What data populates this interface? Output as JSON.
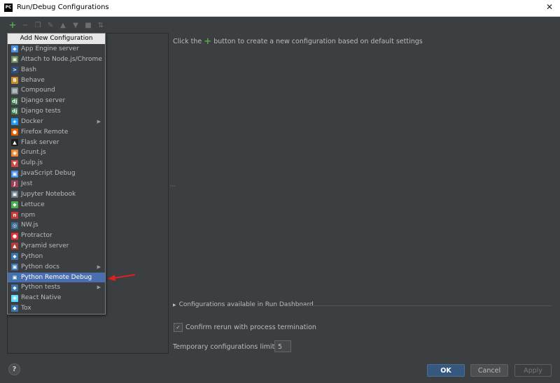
{
  "window": {
    "title": "Run/Debug Configurations",
    "app_icon_text": "PC"
  },
  "toolbar": {
    "buttons": [
      "plus-icon",
      "minus-icon",
      "copy-icon",
      "wrench-icon",
      "arrow-up-icon",
      "arrow-down-icon",
      "folder-icon",
      "sort-icon"
    ]
  },
  "popup": {
    "header": "Add New Configuration",
    "items": [
      {
        "label": "App Engine server",
        "icon": "app-engine-icon",
        "color": "#4a8ee8"
      },
      {
        "label": "Attach to Node.js/Chrome",
        "icon": "attach-icon",
        "color": "#6a8759"
      },
      {
        "label": "Bash",
        "icon": "bash-icon",
        "color": "#2d4f7a"
      },
      {
        "label": "Behave",
        "icon": "behave-icon",
        "color": "#c78d2c"
      },
      {
        "label": "Compound",
        "icon": "compound-icon",
        "color": "#7e8b8f"
      },
      {
        "label": "Django server",
        "icon": "django-icon",
        "color": "#3f7a4f"
      },
      {
        "label": "Django tests",
        "icon": "django-tests-icon",
        "color": "#3f7a4f"
      },
      {
        "label": "Docker",
        "icon": "docker-icon",
        "color": "#2496ed",
        "submenu": true
      },
      {
        "label": "Firefox Remote",
        "icon": "firefox-icon",
        "color": "#e66000"
      },
      {
        "label": "Flask server",
        "icon": "flask-icon",
        "color": "#1e1e1e"
      },
      {
        "label": "Grunt.js",
        "icon": "grunt-icon",
        "color": "#e48632"
      },
      {
        "label": "Gulp.js",
        "icon": "gulp-icon",
        "color": "#cf4647"
      },
      {
        "label": "JavaScript Debug",
        "icon": "js-debug-icon",
        "color": "#4a8ee8"
      },
      {
        "label": "Jest",
        "icon": "jest-icon",
        "color": "#99425b"
      },
      {
        "label": "Jupyter Notebook",
        "icon": "jupyter-icon",
        "color": "#6a7a8a"
      },
      {
        "label": "Lettuce",
        "icon": "lettuce-icon",
        "color": "#4caf50"
      },
      {
        "label": "npm",
        "icon": "npm-icon",
        "color": "#cb3837"
      },
      {
        "label": "NW.js",
        "icon": "nwjs-icon",
        "color": "#3d6b94"
      },
      {
        "label": "Protractor",
        "icon": "protractor-icon",
        "color": "#e23237"
      },
      {
        "label": "Pyramid server",
        "icon": "pyramid-icon",
        "color": "#b33a3a"
      },
      {
        "label": "Python",
        "icon": "python-icon",
        "color": "#3a75b0"
      },
      {
        "label": "Python docs",
        "icon": "python-docs-icon",
        "color": "#3a75b0",
        "submenu": true
      },
      {
        "label": "Python Remote Debug",
        "icon": "python-remote-debug-icon",
        "color": "#3a75b0",
        "selected": true
      },
      {
        "label": "Python tests",
        "icon": "python-tests-icon",
        "color": "#3a75b0",
        "submenu": true
      },
      {
        "label": "React Native",
        "icon": "react-icon",
        "color": "#61dafb"
      },
      {
        "label": "Tox",
        "icon": "tox-icon",
        "color": "#3a75b0"
      }
    ]
  },
  "main": {
    "hint_before": "Click the",
    "hint_plus": "+",
    "hint_after": "button to create a new configuration based on default settings",
    "dashboard_label": "Configurations available in Run Dashboard",
    "confirm_label": "Confirm rerun with process termination",
    "confirm_checked": true,
    "limit_label": "Temporary configurations limit:",
    "limit_value": "5"
  },
  "buttons": {
    "help": "?",
    "ok": "OK",
    "cancel": "Cancel",
    "apply": "Apply"
  },
  "colors": {
    "background": "#3c3f41",
    "selection": "#4b6eaf",
    "ok_button": "#365880",
    "annotation_arrow": "#e02020"
  }
}
